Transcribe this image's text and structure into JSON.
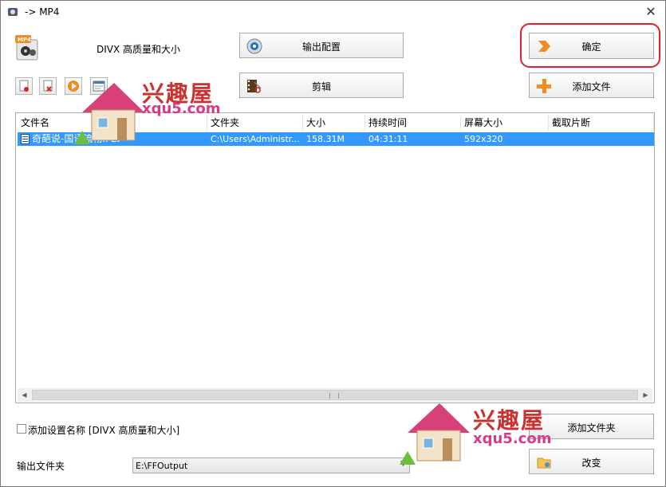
{
  "window": {
    "title": "-> MP4"
  },
  "format": {
    "label": "DIVX 高质量和大小",
    "badge": "MP4"
  },
  "toolbar": {
    "output_config_label": "输出配置",
    "clip_label": "剪辑",
    "ok_label": "确定",
    "add_file_label": "添加文件",
    "add_folder_label": "添加文件夹",
    "change_label": "改变"
  },
  "file_list": {
    "columns": [
      "文件名",
      "文件夹",
      "大小",
      "持续时间",
      "屏幕大小",
      "截取片断"
    ],
    "rows": [
      {
        "name": "奇葩说-国语流畅.FLV",
        "folder": "C:\\Users\\Administr...",
        "size": "158.31M",
        "duration": "04:31:11",
        "screen_size": "592x320",
        "clip": ""
      }
    ]
  },
  "options": {
    "add_setting_name_label": "添加设置名称 [DIVX 高质量和大小]",
    "add_setting_name_checked": false
  },
  "output": {
    "label": "输出文件夹",
    "folder_value": "E:\\FFOutput"
  },
  "watermark": {
    "cn": "兴趣屋",
    "en": "xqu5.com"
  },
  "colors": {
    "selection": "#3399ff",
    "highlight_ring": "#e0202a",
    "accent_orange": "#f28c1e"
  }
}
